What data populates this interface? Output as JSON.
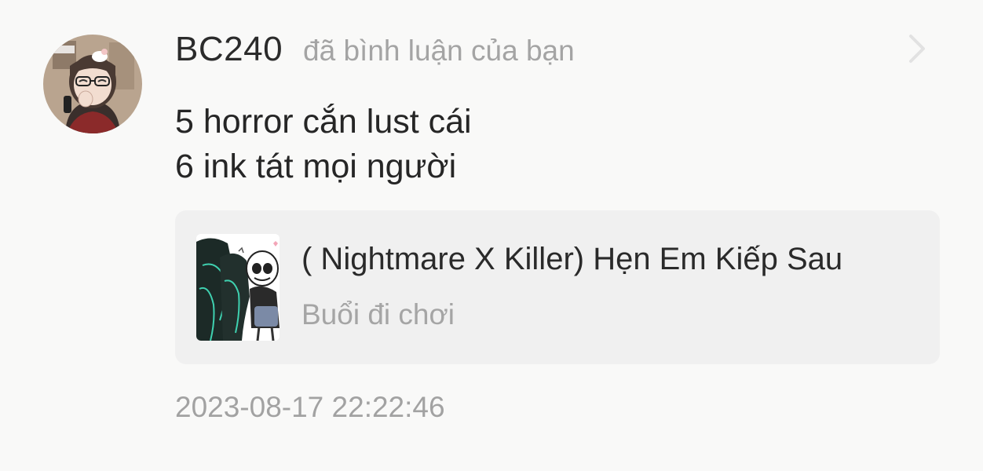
{
  "notification": {
    "username": "BC240",
    "action_text": "đã bình luận của bạn",
    "comment_lines": [
      "5 horror cắn lust cái",
      "6 ink tát mọi người"
    ],
    "story": {
      "title": "( Nightmare X Killer) Hẹn Em Kiếp Sau",
      "chapter": "Buổi đi chơi"
    },
    "timestamp": "2023-08-17 22:22:46",
    "icons": {
      "avatar": "user-avatar",
      "chevron": "chevron-right-icon",
      "thumbnail": "story-cover-thumbnail"
    },
    "colors": {
      "background": "#f9f9f8",
      "card": "#f0f0f0",
      "primary_text": "#2b2b2b",
      "secondary_text": "#a4a4a4"
    }
  }
}
